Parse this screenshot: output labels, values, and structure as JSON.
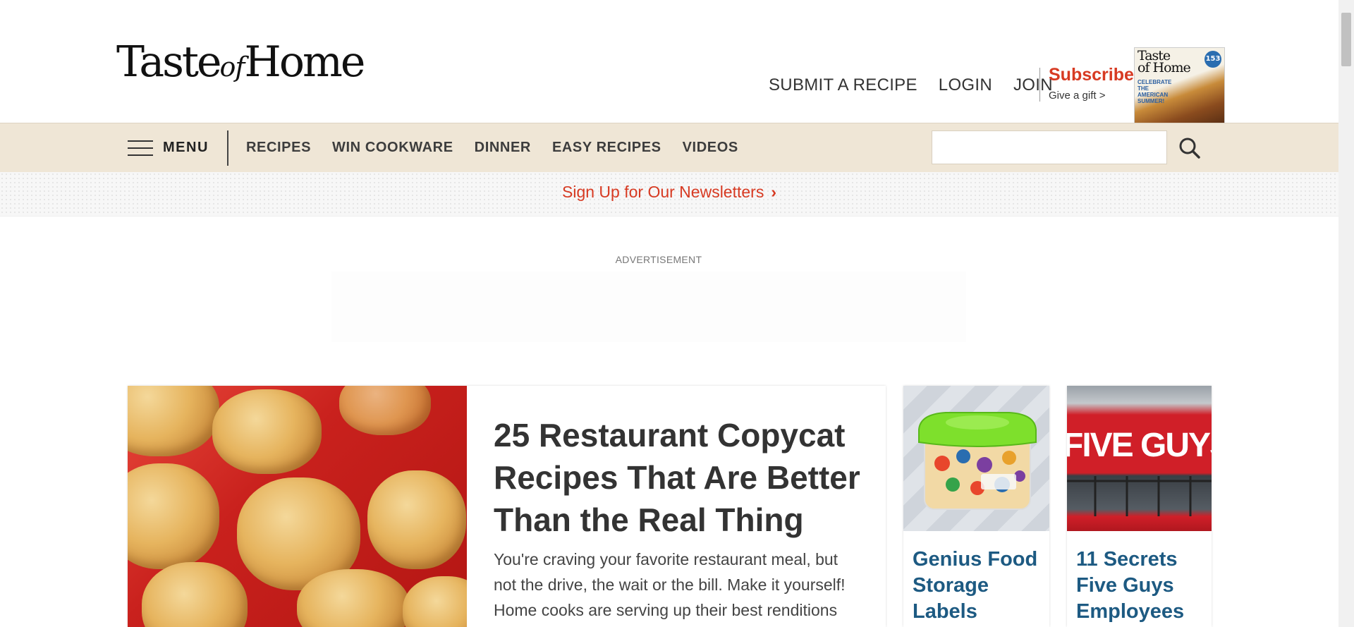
{
  "header": {
    "logo_text_1": "Taste",
    "logo_text_2": "of",
    "logo_text_3": "Home",
    "links": [
      "SUBMIT A RECIPE",
      "LOGIN",
      "JOIN"
    ],
    "subscribe_label": "Subscribe",
    "gift_label": "Give a gift >",
    "magazine": {
      "title_1": "Taste",
      "title_2": "of Home",
      "badge": "153",
      "headline": "CELEBRATE THE AMERICAN SUMMER!"
    }
  },
  "nav": {
    "menu_label": "MENU",
    "links": [
      "RECIPES",
      "WIN COOKWARE",
      "DINNER",
      "EASY RECIPES",
      "VIDEOS"
    ],
    "search_placeholder": "",
    "search_icon": "magnifier-icon"
  },
  "newsletter": {
    "label": "Sign Up for Our Newsletters",
    "chevron": "›"
  },
  "ad": {
    "label": "ADVERTISEMENT"
  },
  "featured": {
    "title": "25 Restaurant Copycat Recipes That Are Better Than the Real Thing",
    "description": "You're craving your favorite restaurant meal, but not the drive, the wait or the bill. Make it yourself! Home cooks are serving up their best renditions"
  },
  "cards": [
    {
      "title": "Genius Food Storage Labels"
    },
    {
      "title": "11 Secrets Five Guys Employees",
      "sign_text": "FIVE GUYS"
    }
  ],
  "colors": {
    "brand_red": "#d73a22",
    "nav_bg": "#efe6d6",
    "card_title_blue": "#1d5a82"
  }
}
